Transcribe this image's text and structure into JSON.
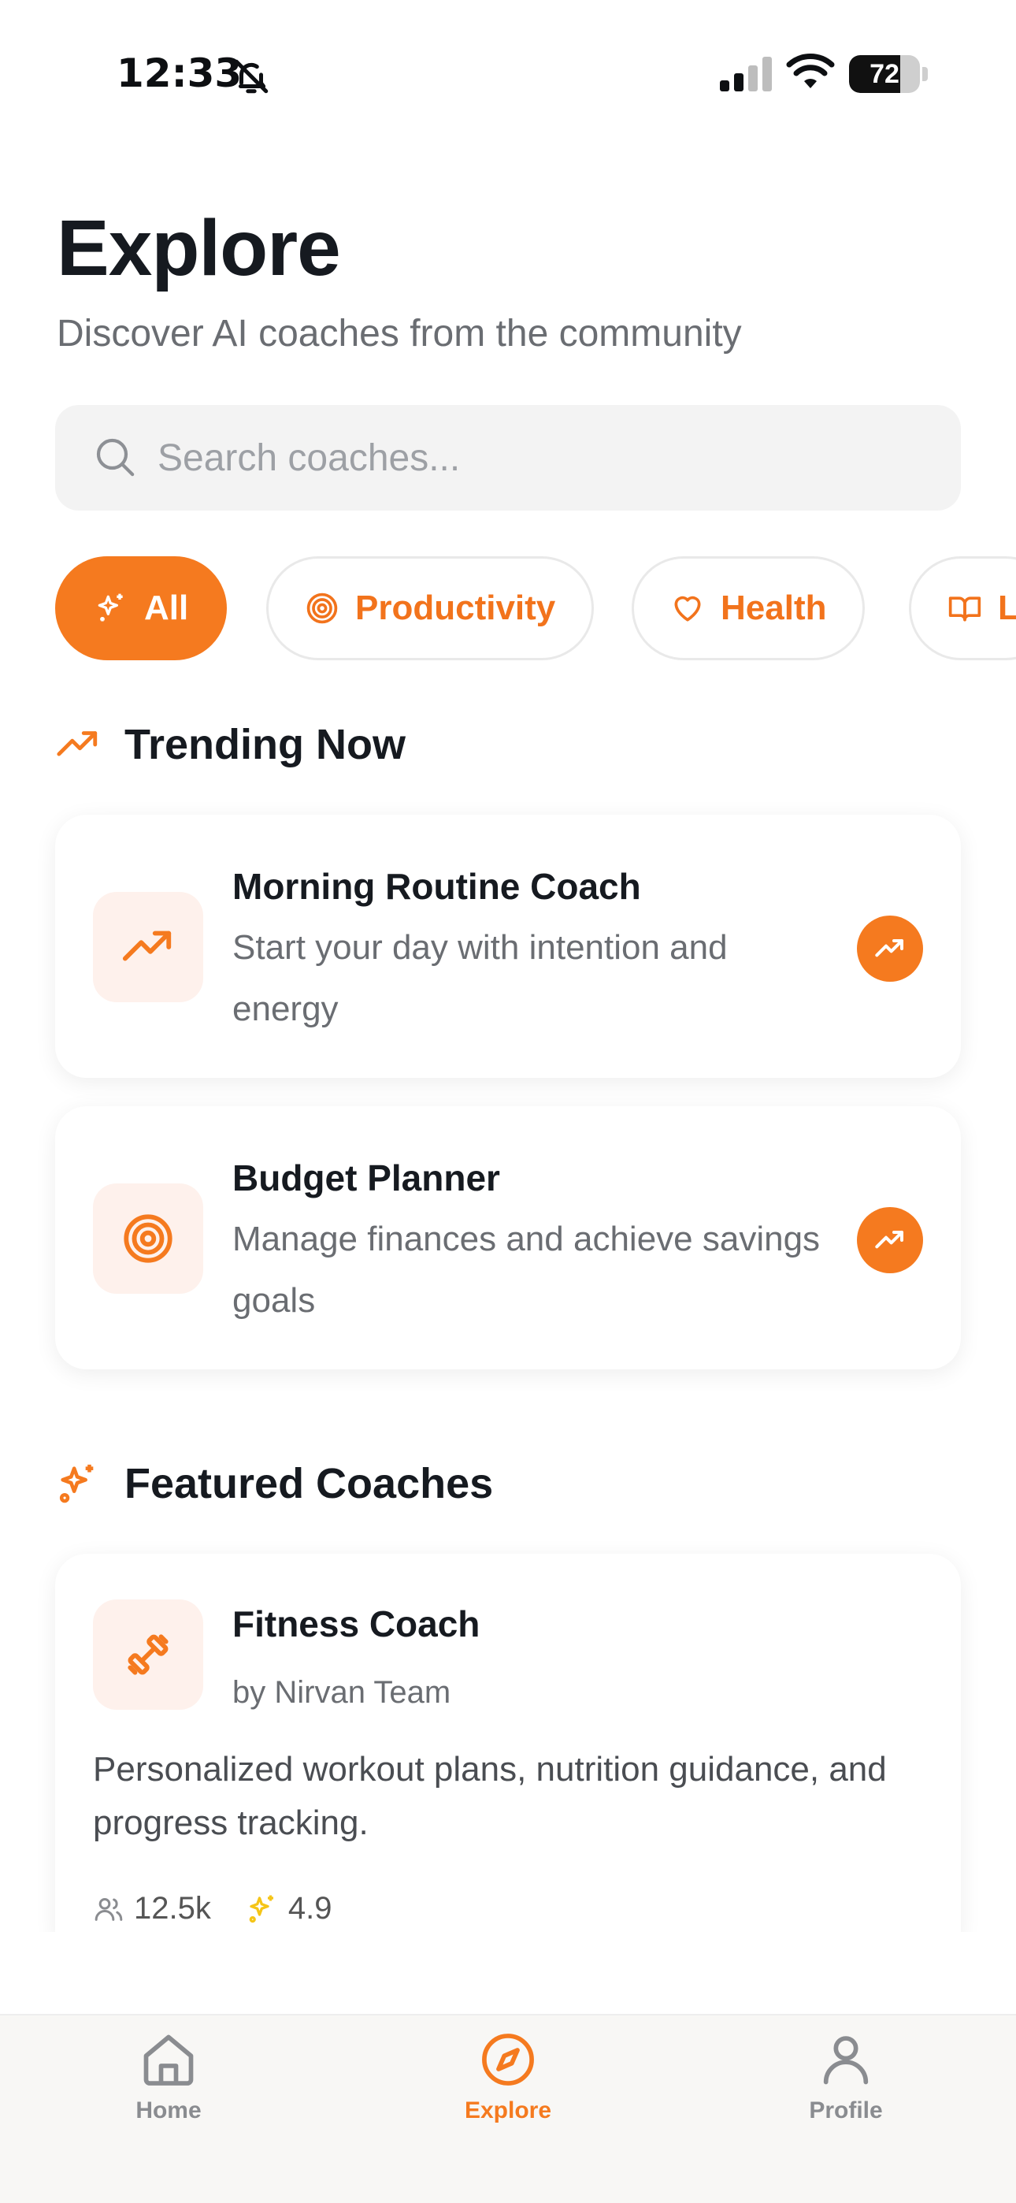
{
  "status_bar": {
    "time": "12:33",
    "battery": "72",
    "battery_level": 0.72,
    "icons": [
      "bell-slash-icon",
      "signal-icon",
      "wifi-icon",
      "battery-icon"
    ]
  },
  "header": {
    "title": "Explore",
    "subtitle": "Discover AI coaches from the community"
  },
  "search": {
    "placeholder": "Search coaches...",
    "value": ""
  },
  "categories": [
    {
      "label": "All",
      "icon": "sparkles-icon",
      "active": true
    },
    {
      "label": "Productivity",
      "icon": "target-icon",
      "active": false
    },
    {
      "label": "Health",
      "icon": "heart-icon",
      "active": false
    },
    {
      "label": "L",
      "icon": "book-icon",
      "active": false
    }
  ],
  "trending": {
    "heading": "Trending Now",
    "items": [
      {
        "title": "Morning Routine Coach",
        "description": "Start your day with intention and energy",
        "icon": "trending-up-icon"
      },
      {
        "title": "Budget Planner",
        "description": "Manage finances and achieve savings goals",
        "icon": "target-icon"
      }
    ]
  },
  "featured": {
    "heading": "Featured Coaches",
    "items": [
      {
        "title": "Fitness Coach",
        "author": "by Nirvan Team",
        "description": "Personalized workout plans, nutrition guidance, and progress tracking.",
        "users": "12.5k",
        "rating": "4.9",
        "icon": "dumbbell-icon"
      }
    ]
  },
  "tabs": [
    {
      "label": "Home",
      "icon": "home-icon",
      "active": false
    },
    {
      "label": "Explore",
      "icon": "compass-icon",
      "active": true
    },
    {
      "label": "Profile",
      "icon": "user-icon",
      "active": false
    }
  ],
  "colors": {
    "accent": "#f57a1f",
    "accent_soft": "#fef1ec",
    "text_primary": "#161a20",
    "text_secondary": "#6a6d72",
    "star": "#f5c518"
  }
}
